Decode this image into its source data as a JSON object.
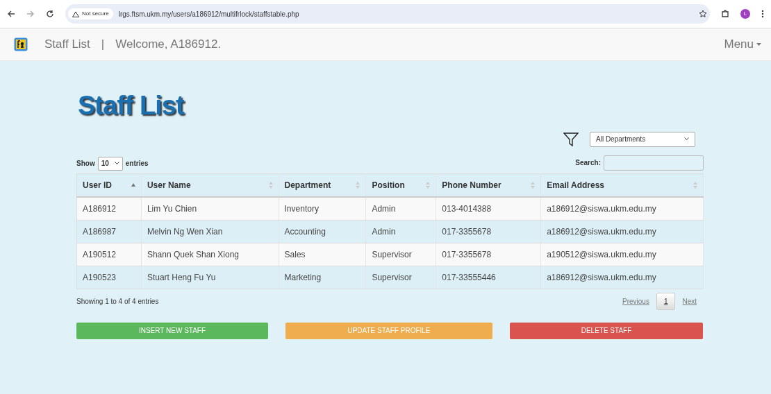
{
  "browser": {
    "security": "Not secure",
    "url": "lrgs.ftsm.ukm.my/users/a186912/multifrlock/staffstable.php",
    "profile": "L"
  },
  "navbar": {
    "brand": "Staff List",
    "separator": "|",
    "welcome": "Welcome, A186912.",
    "menu": "Menu"
  },
  "page_title": "Staff List",
  "department_filter": {
    "value": "All Departments"
  },
  "length": {
    "prefix": "Show",
    "value": "10",
    "suffix": "entries"
  },
  "search": {
    "label": "Search:"
  },
  "table": {
    "columns": [
      {
        "label": "User ID",
        "sorted": true
      },
      {
        "label": "User Name",
        "sorted": false
      },
      {
        "label": "Department",
        "sorted": false
      },
      {
        "label": "Position",
        "sorted": false
      },
      {
        "label": "Phone Number",
        "sorted": false
      },
      {
        "label": "Email Address",
        "sorted": false
      }
    ],
    "rows": [
      [
        "A186912",
        "Lim Yu Chien",
        "Inventory",
        "Admin",
        "013-4014388",
        "a186912@siswa.ukm.edu.my"
      ],
      [
        "A186987",
        "Melvin Ng Wen Xian",
        "Accounting",
        "Admin",
        "017-3355678",
        "a186912@siswa.ukm.edu.my"
      ],
      [
        "A190512",
        "Shann Quek Shan Xiong",
        "Sales",
        "Supervisor",
        "017-3355678",
        "a190512@siswa.ukm.edu.my"
      ],
      [
        "A190523",
        "Stuart Heng Fu Yu",
        "Marketing",
        "Supervisor",
        "017-33555446",
        "a186912@siswa.ukm.edu.my"
      ]
    ]
  },
  "info": "Showing 1 to 4 of 4 entries",
  "pagination": [
    {
      "label": "Previous",
      "selected": false
    },
    {
      "label": "1",
      "selected": true
    },
    {
      "label": "Next",
      "selected": false
    }
  ],
  "buttons": [
    {
      "label": "INSERT NEW STAFF",
      "kind": "success"
    },
    {
      "label": "UPDATE STAFF PROFILE",
      "kind": "warning"
    },
    {
      "label": "DELETE STAFF",
      "kind": "danger"
    }
  ]
}
